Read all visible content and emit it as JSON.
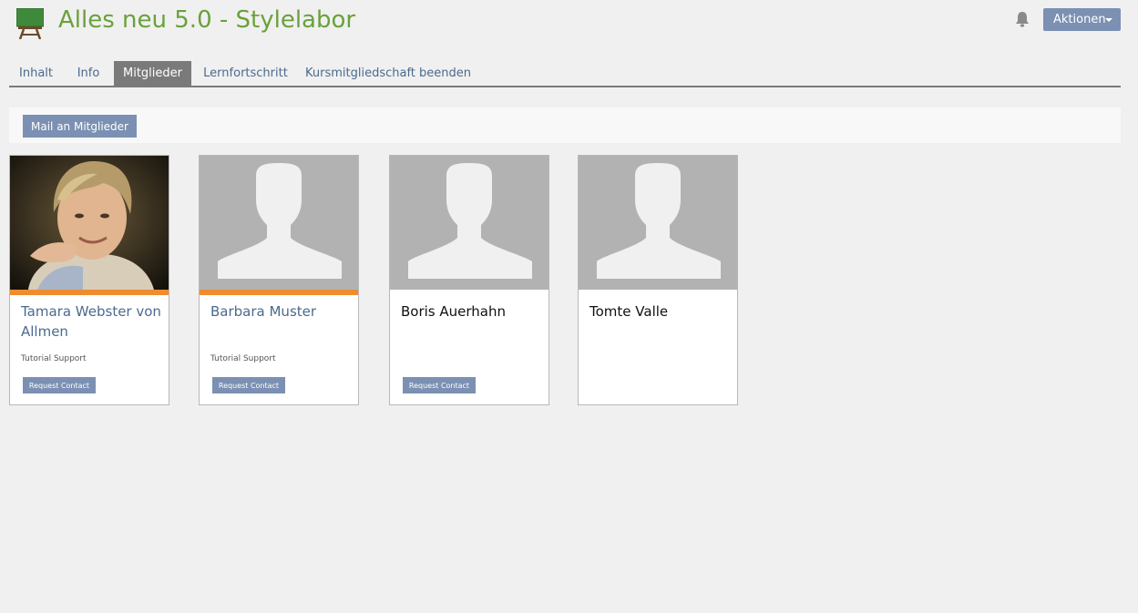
{
  "header": {
    "title": "Alles neu 5.0 - Stylelabor",
    "actions_label": "Aktionen",
    "course_icon": "easel-icon",
    "notification_icon": "bell-icon"
  },
  "tabs": [
    {
      "label": "Inhalt",
      "active": false
    },
    {
      "label": "Info",
      "active": false
    },
    {
      "label": "Mitglieder",
      "active": true
    },
    {
      "label": "Lernfortschritt",
      "active": false
    },
    {
      "label": "Kursmitgliedschaft beenden",
      "active": false
    }
  ],
  "toolbar": {
    "mail_label": "Mail an Mitglieder"
  },
  "members": [
    {
      "name": "Tamara Webster von Allmen",
      "role": "Tutorial Support",
      "button": "Request Contact",
      "photo": "portrait-photo"
    },
    {
      "name": "Barbara Muster",
      "role": "Tutorial Support",
      "button": "Request Contact",
      "photo": "avatar-placeholder-icon"
    },
    {
      "name": "Boris Auerhahn",
      "role": "",
      "button": "Request Contact",
      "photo": "avatar-placeholder-icon"
    },
    {
      "name": "Tomte Valle",
      "role": "",
      "button": "",
      "photo": "avatar-placeholder-icon"
    }
  ],
  "colors": {
    "title_green": "#6aa13b",
    "link_blue": "#4a6a8f",
    "button_blue": "#7b90b2",
    "accent_orange": "#ef8c2f",
    "active_tab_gray": "#7a7a7a"
  }
}
